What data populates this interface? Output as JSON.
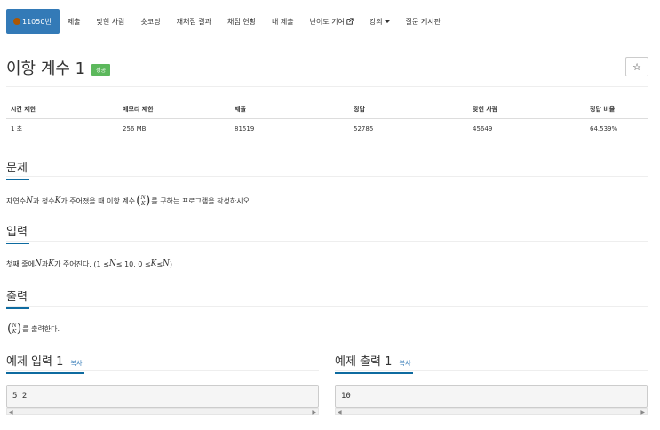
{
  "nav": {
    "items": [
      "11050번",
      "제출",
      "맞힌 사람",
      "숏코딩",
      "재채점 결과",
      "채점 현황",
      "내 제출",
      "난이도 기여",
      "강의",
      "질문 게시판"
    ]
  },
  "problem": {
    "title": "이항 계수 1",
    "status_badge": "성공",
    "star_icon": "☆"
  },
  "info_table": {
    "headers": [
      "시간 제한",
      "메모리 제한",
      "제출",
      "정답",
      "맞힌 사람",
      "정답 비율"
    ],
    "values": [
      "1 초",
      "256 MB",
      "81519",
      "52785",
      "45649",
      "64.539%"
    ]
  },
  "sections": {
    "description": {
      "heading": "문제",
      "text_before": "자연수 ",
      "var_n": "N",
      "text_mid1": "과 정수 ",
      "var_k": "K",
      "text_mid2": "가 주어졌을 때 이항 계수 ",
      "text_after": "를 구하는 프로그램을 작성하시오."
    },
    "input": {
      "heading": "입력",
      "text_before": "첫째 줄에 ",
      "var_n": "N",
      "text_mid": "과 ",
      "var_k": "K",
      "text_mid2": "가 주어진다. (1 ≤ ",
      "cond1_var": "N",
      "cond1": " ≤ 10, 0 ≤ ",
      "cond2_var_k": "K",
      "cond2": " ≤ ",
      "cond2_var_n": "N",
      "close": ")"
    },
    "output": {
      "heading": "출력",
      "text_after": "를 출력한다."
    },
    "binom_top": "N",
    "binom_bottom": "K"
  },
  "examples": {
    "input_heading": "예제 입력 1",
    "output_heading": "예제 출력 1",
    "copy_label": "복사",
    "input_value": "5 2",
    "output_value": "10"
  }
}
